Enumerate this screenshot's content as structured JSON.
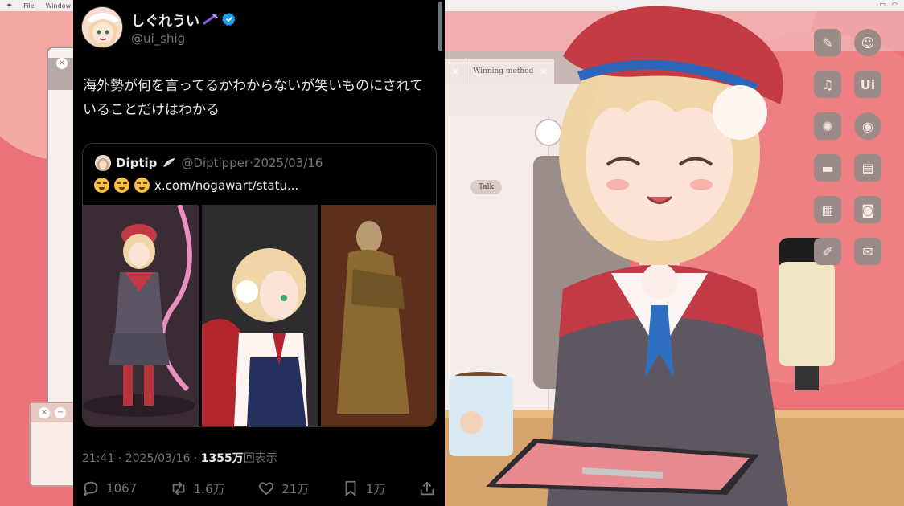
{
  "menubar": {
    "items": [
      "File",
      "Window"
    ]
  },
  "tweet": {
    "author": {
      "display_name": "しぐれうい",
      "handle": "@ui_shig"
    },
    "text": "海外勢が何を言ってるかわからないが笑いものにされていることだけはわかる",
    "quote": {
      "name": "Diptip",
      "handle": "@Diptipper",
      "separator": "·",
      "date": "2025/03/16",
      "link_text": "x.com/nogawart/statu..."
    },
    "meta": {
      "time": "21:41",
      "separator": "·",
      "date": "2025/03/16",
      "separator2": "·",
      "views_count": "1355万",
      "views_label": "回表示"
    },
    "actions": {
      "replies": "1067",
      "reposts": "1.6万",
      "likes": "21万",
      "bookmarks": "1万"
    }
  },
  "background": {
    "browser_tab_label": "Winning method",
    "talk_chip": "Talk",
    "app_icon_labels": [
      "Ui"
    ]
  },
  "colors": {
    "tweet_bg": "#000000",
    "text_primary": "#e7e9ea",
    "text_secondary": "#71767b",
    "verified_blue": "#1d9bf0",
    "scene_pink": "#ec7178"
  }
}
